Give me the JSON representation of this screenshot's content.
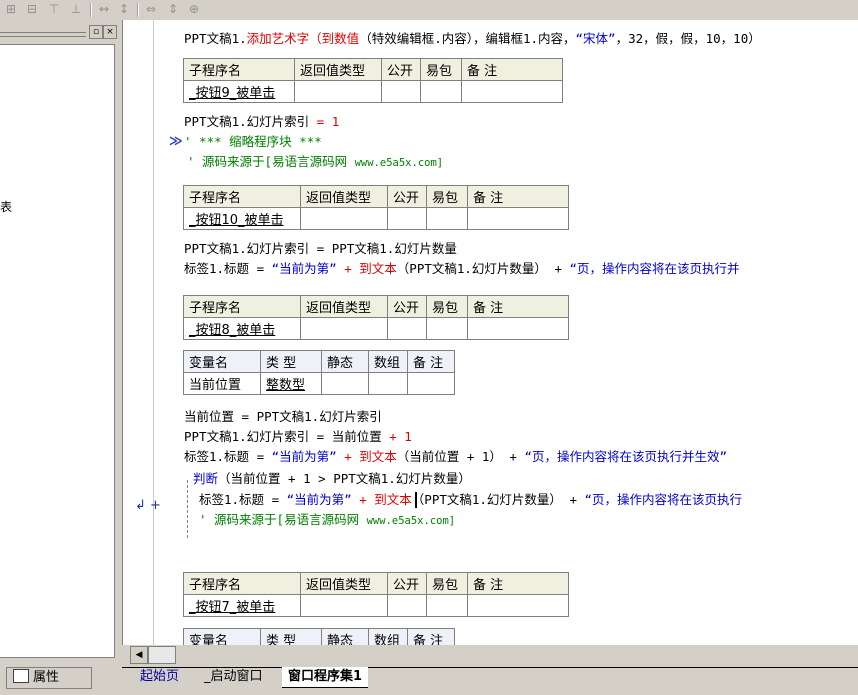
{
  "toolbar": {
    "icons": [
      "align-left-icon",
      "align-center-icon",
      "align-top-icon",
      "align-middle-icon",
      "same-width-icon",
      "same-height-icon",
      "h-space-icon",
      "v-space-icon",
      "center-icon"
    ]
  },
  "left_panel": {
    "partial_text": "表",
    "properties_tab": "属性"
  },
  "code": {
    "line1_prefix": "PPT文稿1.",
    "line1_fn": "添加艺术字",
    "line1_paren_open": "（",
    "line1_fn2": "到数值",
    "line1_rest": "（特效编辑框.内容），编辑框1.内容，",
    "line1_str": "“宋体”",
    "line1_args": "，32，假，假，10，10）",
    "sub_headers": [
      "子程序名",
      "返回值类型",
      "公开",
      "易包",
      "备 注"
    ],
    "sub1_name": "_按钮9_被单击",
    "sub1_line1_a": "PPT文稿1.幻灯片索引 ",
    "sub1_line1_op": "=",
    "sub1_line1_val": " 1",
    "collapsed_marker": "≫",
    "collapsed_text": "' *** 缩略程序块 ***",
    "source_comment_1": "' 源码来源于[易语言源码网 ",
    "source_url": "www.e5a5x.com]",
    "sub2_name": "_按钮10_被单击",
    "sub2_line1": "PPT文稿1.幻灯片索引 = PPT文稿1.幻灯片数量",
    "sub2_line2_a": "标签1.标题 = ",
    "sub2_line2_str1": "“当前为第”",
    "sub2_line2_plus": " + ",
    "sub2_line2_fn": "到文本",
    "sub2_line2_rest": "（PPT文稿1.幻灯片数量） + ",
    "sub2_line2_str2": "“页，操作内容将在该页执行并",
    "sub3_name": "_按钮8_被单击",
    "var_headers": [
      "变量名",
      "类 型",
      "静态",
      "数组",
      "备 注"
    ],
    "var1_name": "当前位置",
    "var1_type": "整数型",
    "sub3_line1": "当前位置 = PPT文稿1.幻灯片索引",
    "sub3_line2_a": "PPT文稿1.幻灯片索引 = 当前位置 ",
    "sub3_line2_b": "+ 1",
    "sub3_line3_a": "标签1.标题 = ",
    "sub3_line3_str1": "“当前为第”",
    "sub3_line3_plus": " + ",
    "sub3_line3_fn": "到文本",
    "sub3_line3_rest": "（当前位置 + 1） + ",
    "sub3_line3_str2": "“页，操作内容将在该页执行并生效”",
    "sub3_if_kw": "判断",
    "sub3_if_rest": "（当前位置 + 1 > PPT文稿1.幻灯片数量）",
    "sub3_if_body_a": "标签1.标题 = ",
    "sub3_if_body_str1": "“当前为第”",
    "sub3_if_body_plus": " + ",
    "sub3_if_body_fn": "到文本",
    "sub3_if_body_rest": "（PPT文稿1.幻灯片数量） + ",
    "sub3_if_body_str2": "“页，操作内容将在该页执行",
    "sub3_comment": "' 源码来源于[易语言源码网 ",
    "sub3_comment_url": "www.e5a5x.com]",
    "gutter_markers": "↲ +",
    "sub4_name": "_按钮7_被单击",
    "var_headers_partial": [
      "变量名",
      "类 型",
      "静态",
      "数组",
      "备 注"
    ]
  },
  "tabs": [
    {
      "label": "起始页",
      "active": false
    },
    {
      "label": "_启动窗口",
      "active": false
    },
    {
      "label": "窗口程序集1",
      "active": true
    }
  ],
  "colors": {
    "keyword_red": "#e00000",
    "number_blue": "#0000d0",
    "comment_green": "#008000",
    "panel_gray": "#d4d0c8"
  }
}
